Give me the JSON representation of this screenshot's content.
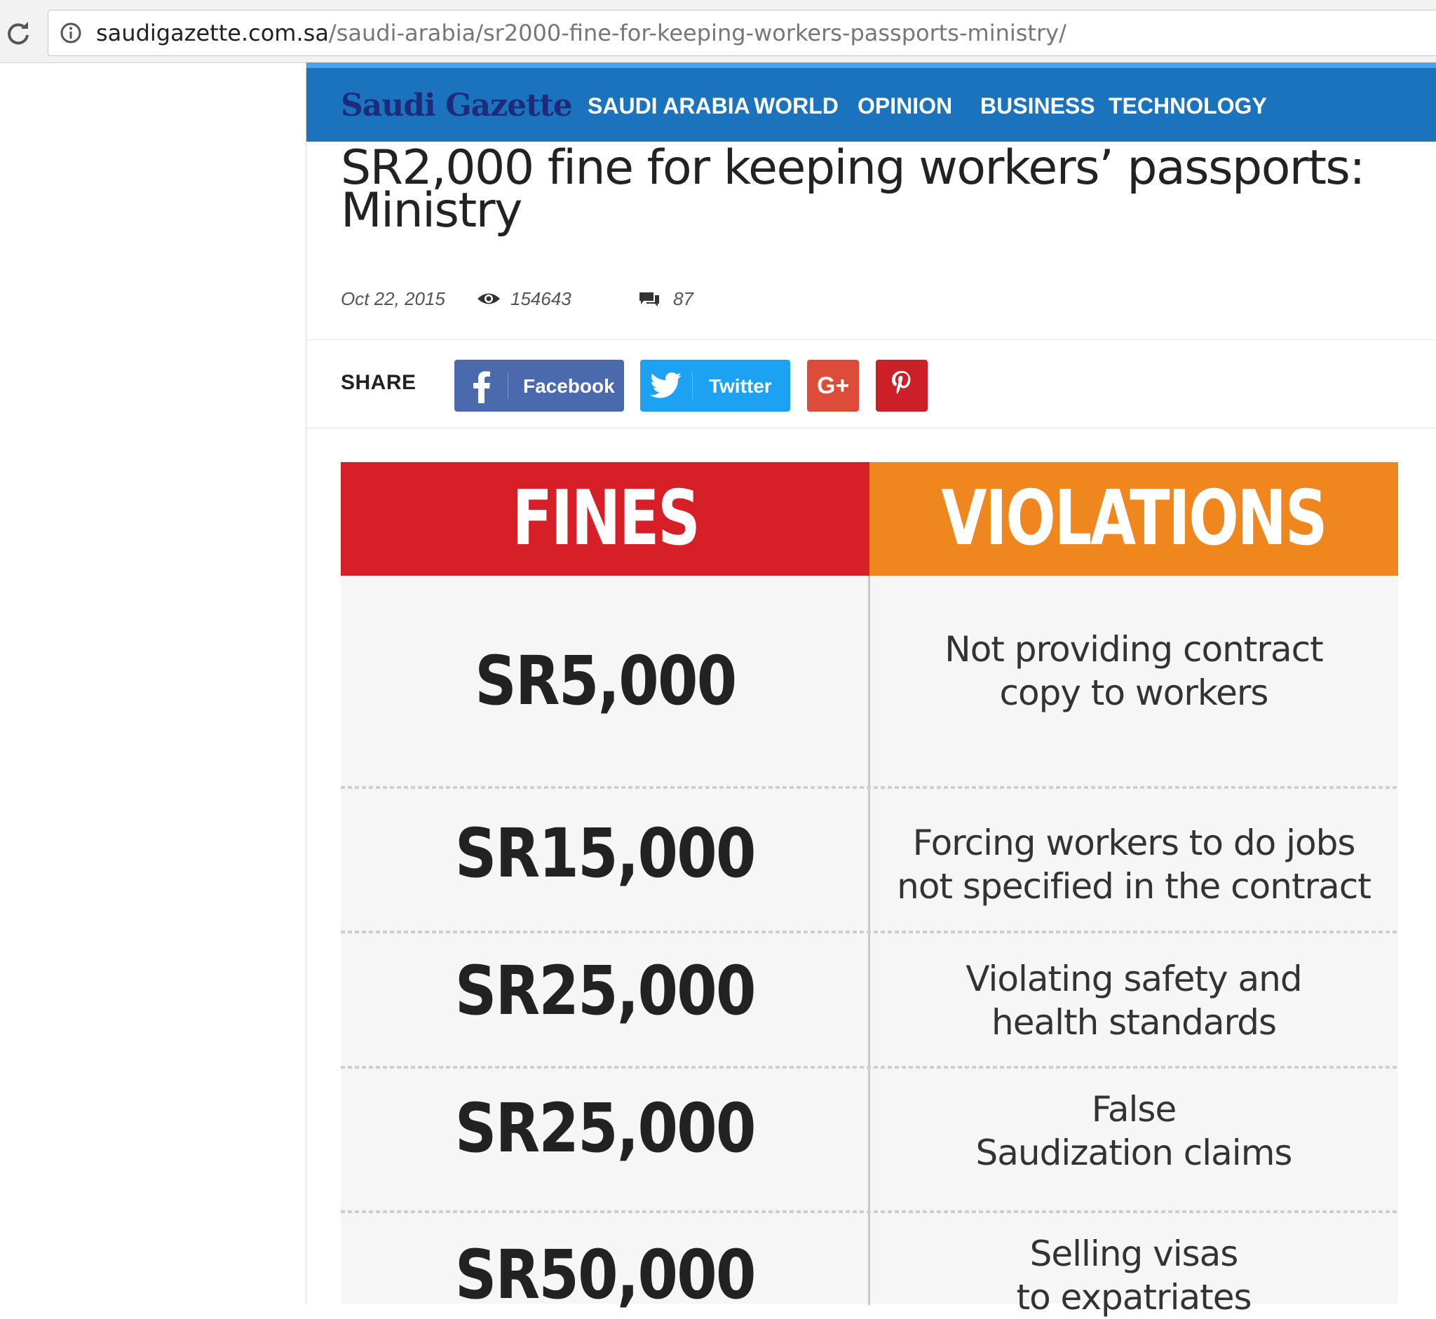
{
  "browser": {
    "url_host": "saudigazette.com.sa",
    "url_path": "/saudi-arabia/sr2000-fine-for-keeping-workers-passports-ministry/"
  },
  "site": {
    "logo": "Saudi Gazette",
    "nav": [
      "SAUDI ARABIA",
      "WORLD",
      "OPINION",
      "BUSINESS",
      "TECHNOLOGY"
    ]
  },
  "article": {
    "headline": "SR2,000 fine for keeping workers’ passports: Ministry",
    "date": "Oct 22, 2015",
    "views": "154643",
    "comments": "87"
  },
  "share": {
    "label": "SHARE",
    "facebook": "Facebook",
    "twitter": "Twitter",
    "gplus": "G+"
  },
  "colors": {
    "nav_bg": "#1b73be",
    "fines_header": "#d61f26",
    "violations_header": "#f0861e",
    "facebook": "#4a6aad",
    "twitter": "#1da1f2",
    "gplus": "#dd4b39",
    "pinterest": "#cb2027"
  },
  "infographic": {
    "headers": {
      "fines": "FINES",
      "violations": "VIOLATIONS"
    },
    "rows": [
      {
        "fine": "SR5,000",
        "violation": [
          "Not providing contract",
          "copy to workers"
        ]
      },
      {
        "fine": "SR15,000",
        "violation": [
          "Forcing workers to do jobs",
          "not specified in the contract"
        ]
      },
      {
        "fine": "SR25,000",
        "violation": [
          "Violating safety and",
          "health standards"
        ]
      },
      {
        "fine": "SR25,000",
        "violation": [
          "False",
          "Saudization claims"
        ]
      },
      {
        "fine": "SR50,000",
        "violation": [
          "Selling visas",
          "to expatriates"
        ]
      }
    ]
  }
}
